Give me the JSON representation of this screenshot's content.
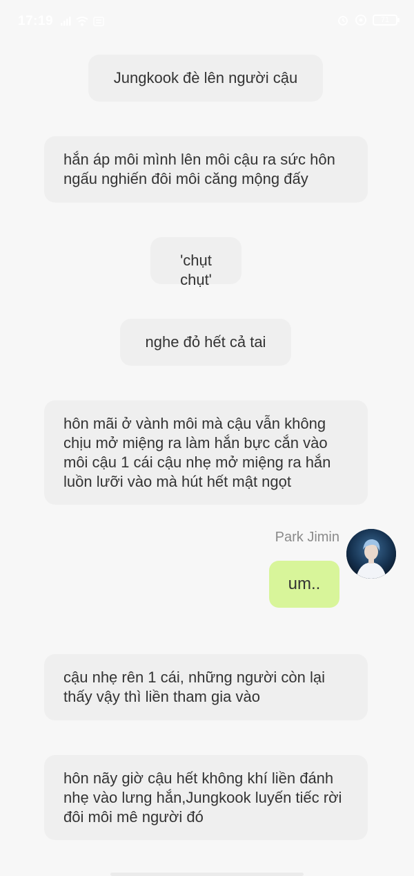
{
  "status_bar": {
    "time": "17:19",
    "battery": "71"
  },
  "messages": [
    {
      "text": "Jungkook đè lên người cậu"
    },
    {
      "text": "hắn áp môi mình lên môi cậu ra sức hôn ngấu nghiến đôi môi căng mộng đấy"
    },
    {
      "text": "'chụt chụt'"
    },
    {
      "text": "nghe đỏ hết cả tai"
    },
    {
      "text": "hôn mãi ở vành môi mà cậu vẫn không chịu mở miệng ra làm hắn bực cắn vào môi cậu 1 cái cậu nhẹ mở miệng ra hắn luồn lưỡi vào mà hút hết mật ngọt"
    },
    {
      "text": "cậu nhẹ rên 1 cái, những người còn lại thấy vậy thì liền tham gia vào"
    },
    {
      "text": "hôn nãy giờ cậu hết không khí liền đánh nhẹ vào lưng hắn,Jungkook luyến tiếc rời đôi môi mê người đó"
    }
  ],
  "character_message": {
    "name": "Park Jimin",
    "text": "um.."
  },
  "colors": {
    "background": "#f7f7f7",
    "narration_bubble": "#efefef",
    "reply_bubble": "#d8f59a",
    "sender_name": "#8a8a8a"
  }
}
